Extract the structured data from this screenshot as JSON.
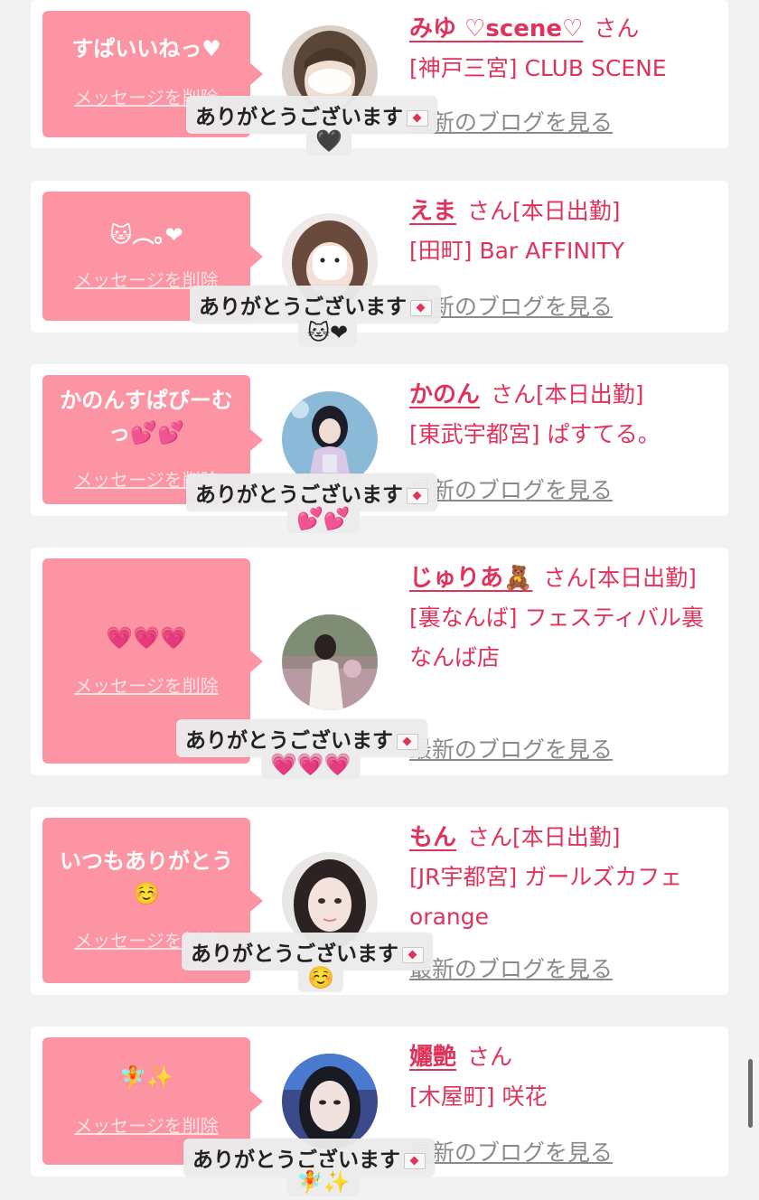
{
  "cards": [
    {
      "message": "すぱいいねっ♥",
      "delete_label": "メッセージを削除",
      "name": "みゆ ♡scene♡",
      "honorific": "さん",
      "shop": "[神戸三宮] CLUB SCENE",
      "blog_label": "最新のブログを見る",
      "toast": "ありがとうございます",
      "toast_line2": "🖤"
    },
    {
      "message": "🐱︵｡❤",
      "delete_label": "メッセージを削除",
      "name": "えま",
      "honorific": "さん[本日出勤]",
      "shop": "[田町] Bar AFFINITY",
      "blog_label": "最新のブログを見る",
      "toast": "ありがとうございます",
      "toast_line2": "🐱❤"
    },
    {
      "message": "かのんすぱぴーむっ💕💕",
      "delete_label": "メッセージを削除",
      "name": "かのん",
      "honorific": "さん[本日出勤]",
      "shop": "[東武宇都宮] ぱすてる。",
      "blog_label": "最新のブログを見る",
      "toast": "ありがとうございます",
      "toast_line2": "💕💕"
    },
    {
      "message": "💗💗💗",
      "delete_label": "メッセージを削除",
      "name": "じゅりあ🧸",
      "honorific": "さん[本日出勤]",
      "shop": "[裏なんば] フェスティバル裏なんば店",
      "blog_label": "最新のブログを見る",
      "toast": "ありがとうございます",
      "toast_line2": "💗💗💗"
    },
    {
      "message": "いつもありがとう☺️",
      "delete_label": "メッセージを削除",
      "name": "もん",
      "honorific": "さん[本日出勤]",
      "shop": "[JR宇都宮] ガールズカフェorange",
      "blog_label": "最新のブログを見る",
      "toast": "ありがとうございます",
      "toast_line2": "☺️"
    },
    {
      "message": "🧚✨",
      "delete_label": "メッセージを削除",
      "name": "孋艶",
      "honorific": "さん",
      "shop": "[木屋町] 咲花",
      "blog_label": "最新のブログを見る",
      "toast": "ありがとうございます",
      "toast_line2": "🧚✨"
    }
  ],
  "colors": {
    "bubble": "#fd94a3",
    "accent": "#e0335c",
    "background": "#f2f2f2"
  }
}
